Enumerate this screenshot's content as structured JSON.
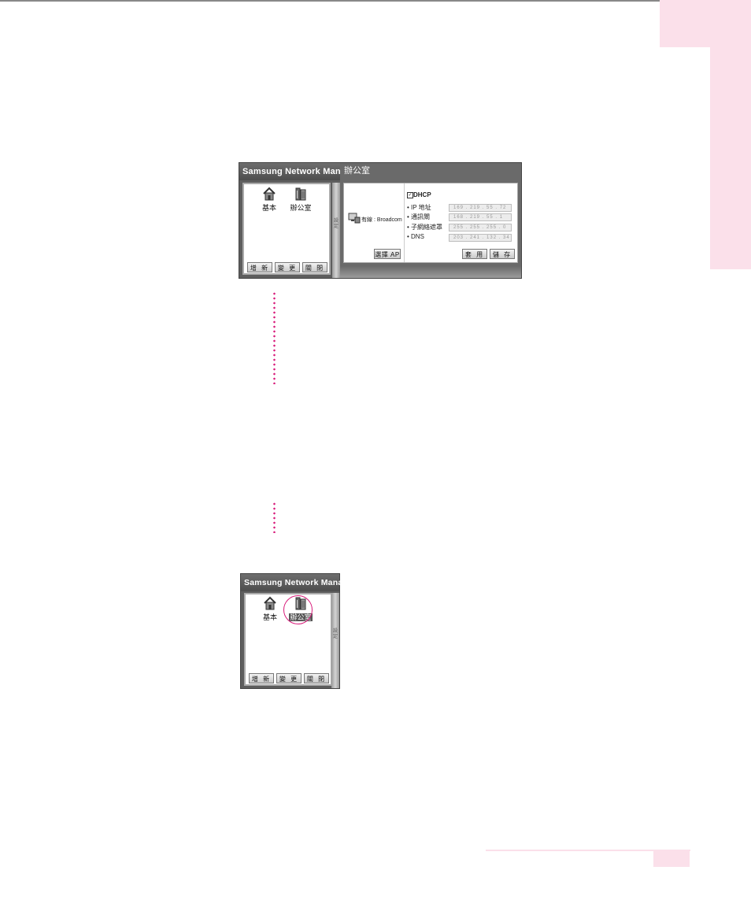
{
  "app_title": "Samsung Network Manager",
  "screen1": {
    "profiles": [
      {
        "label": "基本",
        "icon": "house-icon"
      },
      {
        "label": "辦公室",
        "icon": "office-building-icon"
      }
    ],
    "buttons": {
      "new": "增 新",
      "change": "變 更",
      "close": "關 閉"
    },
    "side_tab_text": "設定",
    "office_title": "辦公室",
    "adapter_label": "有線 : Broadcom",
    "select_ap": "選擇 AP",
    "dhcp_label": "DHCP",
    "fields": [
      {
        "label": "IP 地址",
        "value": "169 . 219 . 55 . 72"
      },
      {
        "label": "通訊閘",
        "value": "168 . 219 . 55 . 1"
      },
      {
        "label": "子網絡遮罩",
        "value": "255 . 255 . 255 . 0"
      },
      {
        "label": "DNS",
        "value": "203 . 241 . 132 . 34"
      }
    ],
    "apply": "套 用",
    "save": "儲 存"
  },
  "screen2": {
    "profiles": [
      {
        "label": "基本",
        "icon": "house-icon"
      },
      {
        "label": "辦公室",
        "icon": "office-building-icon"
      }
    ],
    "buttons": {
      "new": "增 新",
      "change": "變 更",
      "close": "關 閉"
    },
    "side_tab_text": "設定"
  },
  "colors": {
    "accent_pink": "#fbe0ea",
    "highlight_magenta": "#d81b7a"
  }
}
